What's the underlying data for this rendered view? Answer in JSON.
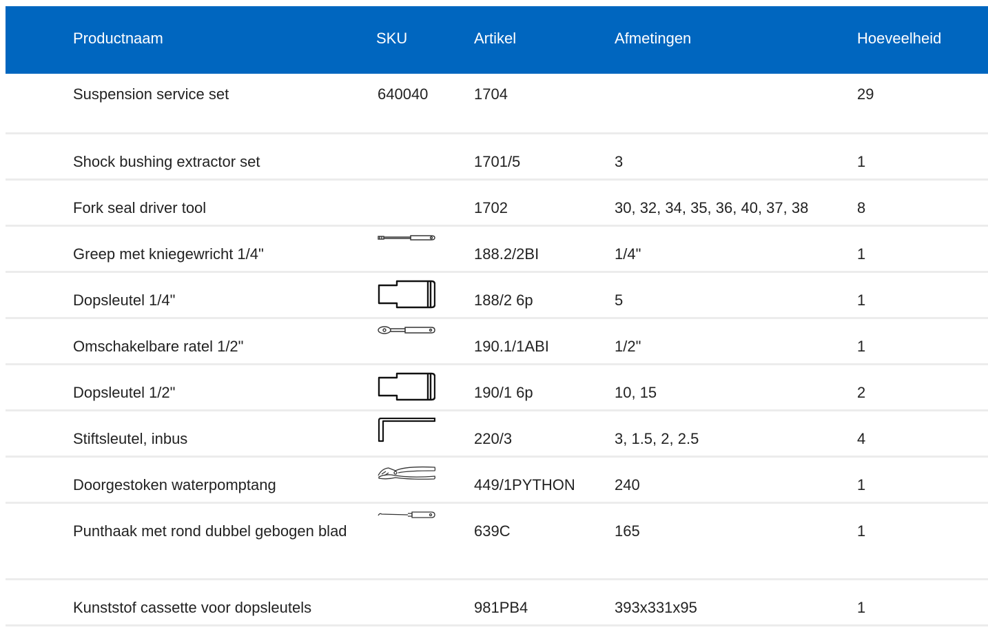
{
  "table": {
    "headers": {
      "product_name": "Productnaam",
      "sku": "SKU",
      "article": "Artikel",
      "dimensions": "Afmetingen",
      "quantity": "Hoeveelheid"
    },
    "rows": [
      {
        "name": "Suspension service set",
        "sku": "640040",
        "icon": "",
        "article": "1704",
        "dimensions": "",
        "quantity": "29"
      },
      {
        "name": "Shock bushing extractor set",
        "sku": "",
        "icon": "",
        "article": "1701/5",
        "dimensions": "3",
        "quantity": "1"
      },
      {
        "name": "Fork seal driver tool",
        "sku": "",
        "icon": "",
        "article": "1702",
        "dimensions": "30, 32, 34, 35, 36, 40, 37, 38",
        "quantity": "8"
      },
      {
        "name": "Greep met kniegewricht 1/4\"",
        "sku": "",
        "icon": "knee-joint-handle-icon",
        "article": "188.2/2BI",
        "dimensions": "1/4\"",
        "quantity": "1"
      },
      {
        "name": "Dopsleutel 1/4\"",
        "sku": "",
        "icon": "socket-icon",
        "article": "188/2 6p",
        "dimensions": "5",
        "quantity": "1"
      },
      {
        "name": "Omschakelbare ratel 1/2\"",
        "sku": "",
        "icon": "ratchet-icon",
        "article": "190.1/1ABI",
        "dimensions": "1/2\"",
        "quantity": "1"
      },
      {
        "name": "Dopsleutel 1/2\"",
        "sku": "",
        "icon": "socket-icon",
        "article": "190/1 6p",
        "dimensions": "10, 15",
        "quantity": "2"
      },
      {
        "name": "Stiftsleutel, inbus",
        "sku": "",
        "icon": "hex-key-icon",
        "article": "220/3",
        "dimensions": "3, 1.5, 2, 2.5",
        "quantity": "4"
      },
      {
        "name": "Doorgestoken waterpomptang",
        "sku": "",
        "icon": "water-pump-pliers-icon",
        "article": "449/1PYTHON",
        "dimensions": "240",
        "quantity": "1"
      },
      {
        "name": "Punthaak met rond dubbel gebogen blad",
        "sku": "",
        "icon": "hook-pick-icon",
        "article": "639C",
        "dimensions": "165",
        "quantity": "1"
      },
      {
        "name": "Kunststof cassette voor dopsleutels",
        "sku": "",
        "icon": "",
        "article": "981PB4",
        "dimensions": "393x331x95",
        "quantity": "1"
      }
    ]
  },
  "colors": {
    "header_bg": "#0066bf",
    "header_text": "#ffffff",
    "row_divider": "#ececec",
    "text": "#222222"
  }
}
